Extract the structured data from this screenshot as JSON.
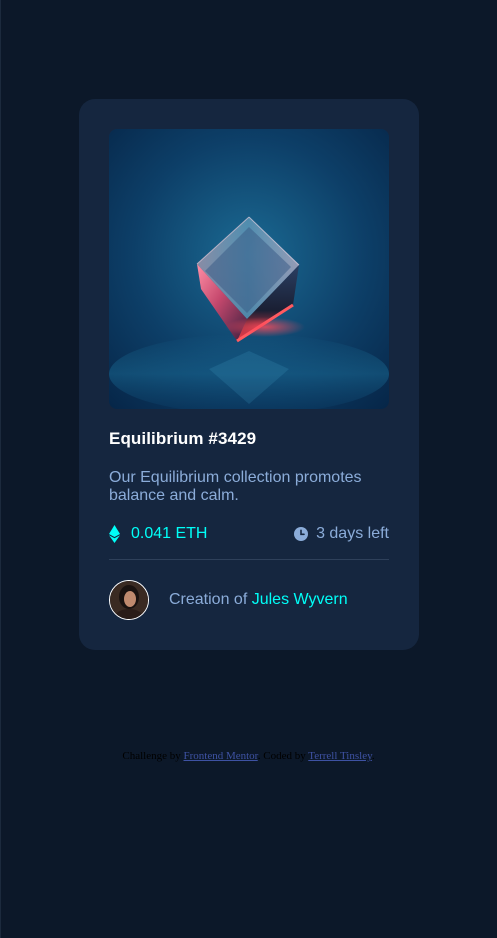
{
  "card": {
    "title": "Equilibrium #3429",
    "description": "Our Equilibrium collection promotes balance and calm.",
    "price": "0.041 ETH",
    "time_left": "3 days left",
    "creator_prefix": "Creation of ",
    "creator_name": "Jules Wyvern"
  },
  "icons": {
    "price": "ethereum-icon",
    "time": "clock-icon"
  },
  "attribution": {
    "prefix": "Challenge by ",
    "link1": "Frontend Mentor",
    "middle": ". Coded by ",
    "link2": "Terrell Tinsley",
    "suffix": "."
  },
  "colors": {
    "background": "#0c1829",
    "card": "#15263f",
    "cyan": "#00fff8",
    "soft_blue": "#8bacd9",
    "white": "#ffffff"
  }
}
